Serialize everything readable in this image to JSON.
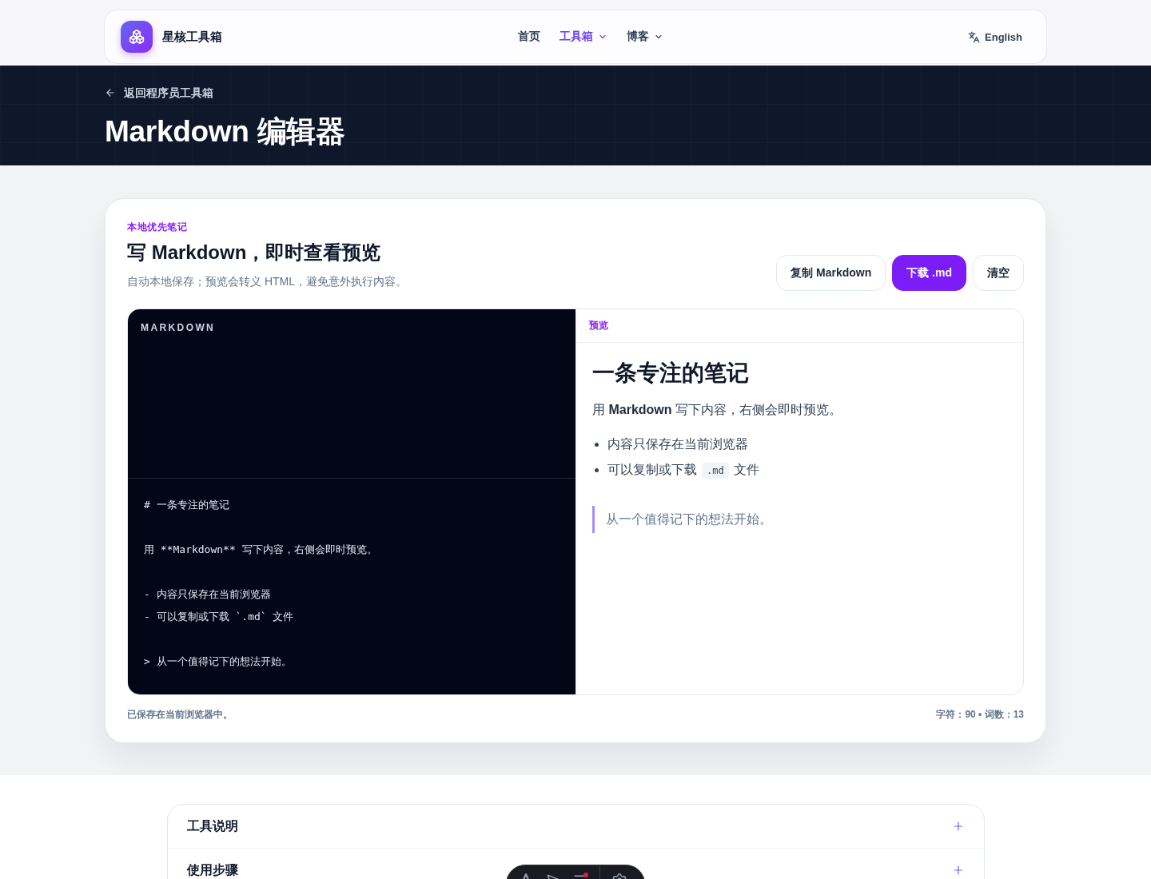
{
  "header": {
    "brand": "星核工具箱",
    "nav": [
      {
        "label": "首页",
        "selected": false,
        "has_menu": false
      },
      {
        "label": "工具箱",
        "selected": true,
        "has_menu": true
      },
      {
        "label": "博客",
        "selected": false,
        "has_menu": true
      }
    ],
    "language": "English"
  },
  "hero": {
    "back_link": "返回程序员工具箱",
    "title": "Markdown 编辑器"
  },
  "editor_card": {
    "eyebrow": "本地优先笔记",
    "title": "写 Markdown，即时查看预览",
    "subtitle": "自动本地保存；预览会转义 HTML，避免意外执行内容。",
    "buttons": [
      {
        "label": "复制 Markdown",
        "kind": "secondary"
      },
      {
        "label": "下载 .md",
        "kind": "primary"
      },
      {
        "label": "清空",
        "kind": "secondary"
      }
    ],
    "source": {
      "label": "MARKDOWN",
      "blocks": [
        [
          "# 一条专注的笔记"
        ],
        [
          "用 **Markdown** 写下内容，右侧会即时预览。"
        ],
        [
          "- 内容只保存在当前浏览器",
          "- 可以复制或下载 `.md` 文件"
        ],
        [
          "> 从一个值得记下的想法开始。"
        ]
      ]
    },
    "preview": {
      "label": "预览",
      "heading": "一条专注的笔记",
      "paragraph": "用 **Markdown** 写下内容，右侧会即时预览。",
      "list": [
        {
          "text": "内容只保存在当前浏览器"
        },
        {
          "text": "可以复制或下载",
          "code": ".md",
          "after": "文件"
        }
      ],
      "quote": "从一个值得记下的想法开始。"
    },
    "status": "已保存在当前浏览器中。",
    "counts": "字符：90 • 词数：13"
  },
  "faq": {
    "items": [
      {
        "title": "工具说明",
        "expanded": false
      },
      {
        "title": "使用步骤",
        "expanded": false
      }
    ]
  }
}
